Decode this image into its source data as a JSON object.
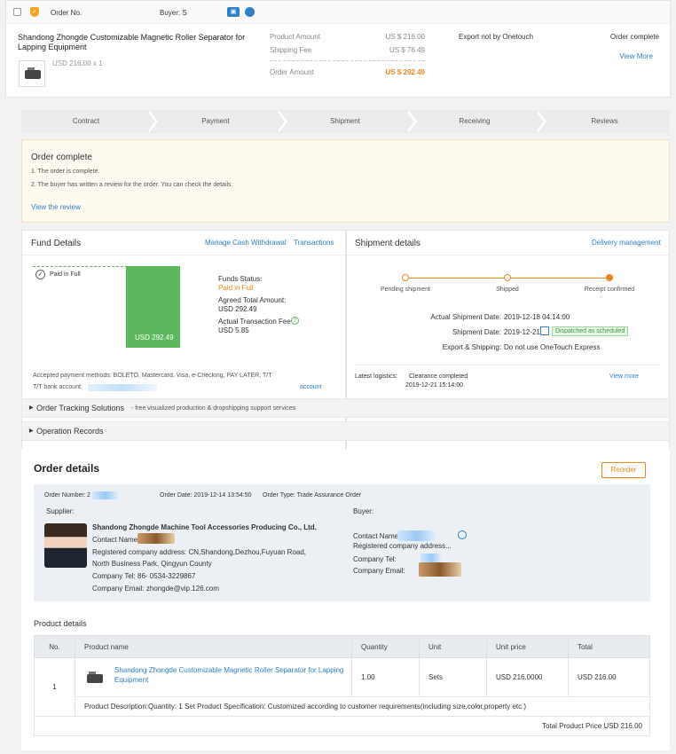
{
  "order_row": {
    "order_no_label": "Order No.",
    "buyer_label": "Buyer: S",
    "product_title": "Shandong Zhongde Customizable Magnetic Roller Separator for Lapping Equipment",
    "price_qty": "USD 216.00 x 1",
    "product_amount_label": "Product Amount",
    "product_amount": "US $ 216.00",
    "shipping_fee_label": "Shipping Fee",
    "shipping_fee": "US $ 76.49",
    "order_amount_label": "Order Amount",
    "order_amount": "US $ 292.49",
    "export_note": "Export not by Onetouch",
    "status": "Order complete",
    "view_more": "View More"
  },
  "steps": [
    "Contract",
    "Payment",
    "Shipment",
    "Receiving",
    "Reviews"
  ],
  "notice": {
    "title": "Order complete",
    "line1": "1. The order is complete.",
    "line2": "2. The buyer has written a review for the order. You can check the details.",
    "link": "View the review"
  },
  "fund": {
    "title": "Fund Details",
    "manage_link": "Manage Cash Withdrawal",
    "transactions_link": "Transactions",
    "paid_label": "Paid in Full",
    "bar_value": "USD 292.49",
    "status_label": "Funds Status:",
    "status_value": "Paid in Full",
    "agreed_label": "Agreed Total Amount:",
    "agreed_value": "USD 292.49",
    "fee_label": "Actual Transaction Fee",
    "fee_value": "USD 5.85",
    "methods": "Accepted payment methods: BOLETO, Mastercard, Visa, e-Checking, PAY LATER, T/T",
    "bank_label": "T/T bank account:",
    "account_link": "account"
  },
  "shipment": {
    "title": "Shipment details",
    "delivery_link": "Delivery management",
    "stages": [
      "Pending shipment",
      "Shipped",
      "Receipt confirmed"
    ],
    "actual_date_label": "Actual Shipment Date:",
    "actual_date": "2019-12-18 04:14:00",
    "ship_date_label": "Shipment Date:",
    "ship_date": "2019-12-21",
    "dispatched_tag": "Dispatched as scheduled",
    "export_label": "Export & Shipping:",
    "export_value": "Do not use OneTouch Express",
    "logistics_label": "Latest logistics:",
    "logistics_status": "Clearance completed",
    "logistics_time": "2019-12-21 15:14:00",
    "view_more": "View more"
  },
  "tracking": {
    "title": "Order Tracking Solutions",
    "subtitle": "- free visualized production & dropshipping support services"
  },
  "operation_records": "Operation Records",
  "details": {
    "title": "Order details",
    "reorder": "Reorder",
    "order_number_label": "Order Number:",
    "order_number_prefix": "2",
    "order_date": "Order Date: 2019-12-14 13:54:50",
    "order_type": "Order Type: Trade Assurance Order",
    "supplier_label": "Supplier:",
    "buyer_label": "Buyer:",
    "supplier_name": "Shandong Zhongde Machine Tool Accessories Producing Co., Ltd.",
    "contact_label": "Contact Name:",
    "address_line1": "Registered company address: CN,Shandong,Dezhou,Fuyuan Road,",
    "address_line2": "North Business Park, Qingyun County",
    "tel": "Company Tel: 86- 0534-3229867",
    "email": "Company Email: zhongde@vip.126.com",
    "buyer_contact_label": "Contact Name:",
    "buyer_address_label": "Registered company address...",
    "buyer_tel_label": "Company Tel:",
    "buyer_email_label": "Company Email:"
  },
  "product_details": {
    "title": "Product details",
    "headers": [
      "No.",
      "Product name",
      "Quantity",
      "Unit",
      "Unit price",
      "Total"
    ],
    "row": {
      "no": "1",
      "name": "Shandong Zhongde Customizable Magnetic Roller Separator for Lapping Equipment",
      "quantity": "1.00",
      "unit": "Sets",
      "unit_price": "USD 216.0000",
      "total": "USD 216.00"
    },
    "description": "Product Description:Quantity: 1 Set Product Specification: Customized according to customer requirements(including size,color,property etc.)",
    "total_label": "Total Product Price",
    "total_value": "USD 216.00"
  },
  "colors": {
    "accent_orange": "#f0861a",
    "link_blue": "#2f80c9",
    "paid_green": "#5cb85c"
  }
}
